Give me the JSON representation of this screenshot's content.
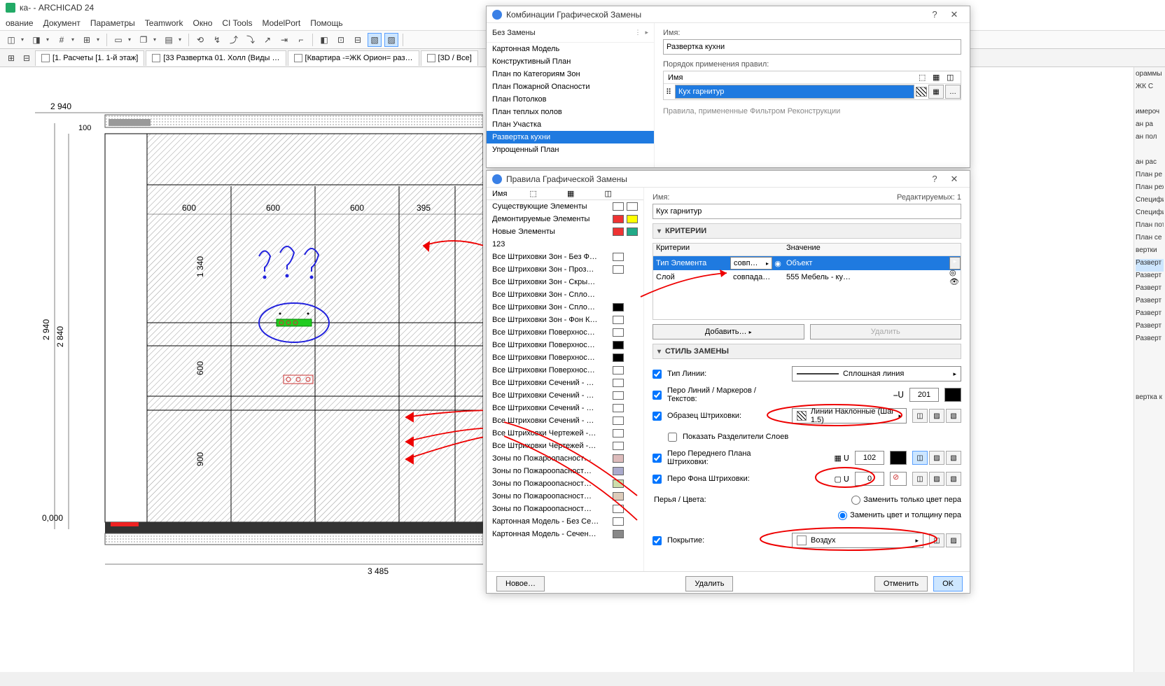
{
  "app": {
    "title": "ка- - ARCHICAD 24"
  },
  "menu": [
    "ование",
    "Документ",
    "Параметры",
    "Teamwork",
    "Окно",
    "CI Tools",
    "ModelPort",
    "Помощь"
  ],
  "tabs": [
    {
      "label": "[1. Расчеты [1. 1-й этаж]"
    },
    {
      "label": "[33 Развертка 01. Холл (Виды …"
    },
    {
      "label": "[Квартира -=ЖК Орион= раз…"
    },
    {
      "label": "[3D / Все]"
    }
  ],
  "rightStrip": [
    "ораммы",
    "ЖК С",
    "",
    "имероч",
    "ан ра",
    "ан пол",
    "",
    "ан рас",
    "План ре",
    "План реж",
    "Специфи",
    "Специфи",
    "План пот",
    "План се",
    "вертки",
    "Разверт",
    "Разверт",
    "Разверт",
    "Разверт",
    "Разверт",
    "Разверт",
    "Разверт",
    "",
    "",
    "вертка к"
  ],
  "dlg1": {
    "title": "Комбинации Графической Замены",
    "leftHeader": "Без Замены",
    "leftList": [
      "Картонная Модель",
      "Конструктивный План",
      "План по Категориям Зон",
      "План Пожарной Опасности",
      "План Потолков",
      "План теплых полов",
      "План Участка",
      "Развертка кухни",
      "Упрощенный План"
    ],
    "selectedIndex": 7,
    "nameLabel": "Имя:",
    "nameValue": "Развертка кухни",
    "orderLabel": "Порядок применения правил:",
    "orderHeader": "Имя",
    "ruleName": "Кух гарнитур",
    "hint": "Правила, примененные Фильтром Реконструкции"
  },
  "dlg2": {
    "title": "Правила Графической Замены",
    "editableLabel": "Редактируемых:",
    "editableCount": "1",
    "leftHeader": "Имя",
    "rules": [
      {
        "name": "Существующие Элементы",
        "c1": "#fff",
        "c2": "#fff"
      },
      {
        "name": "Демонтируемые Элементы",
        "c1": "#e33",
        "c2": "#ff0"
      },
      {
        "name": "Новые Элементы",
        "c1": "#e33",
        "c2": "#2a8"
      },
      {
        "name": "123",
        "c1": "",
        "c2": ""
      },
      {
        "name": "Все Штриховки Зон - Без Ф…",
        "c1": "#fff",
        "c2": ""
      },
      {
        "name": "Все Штриховки Зон - Проз…",
        "c1": "#fff",
        "c2": ""
      },
      {
        "name": "Все Штриховки Зон - Скры…",
        "c1": "",
        "c2": ""
      },
      {
        "name": "Все Штриховки Зон - Спло…",
        "c1": "",
        "c2": ""
      },
      {
        "name": "Все Штриховки Зон - Спло…",
        "c1": "#000",
        "c2": ""
      },
      {
        "name": "Все Штриховки Зон - Фон К…",
        "c1": "#fff",
        "c2": ""
      },
      {
        "name": "Все Штриховки Поверхнос…",
        "c1": "#fff",
        "c2": ""
      },
      {
        "name": "Все Штриховки Поверхнос…",
        "c1": "#000",
        "c2": ""
      },
      {
        "name": "Все Штриховки Поверхнос…",
        "c1": "#000",
        "c2": ""
      },
      {
        "name": "Все Штриховки Поверхнос…",
        "c1": "#fff",
        "c2": ""
      },
      {
        "name": "Все Штриховки Сечений - …",
        "c1": "#fff",
        "c2": ""
      },
      {
        "name": "Все Штриховки Сечений - …",
        "c1": "#fff",
        "c2": ""
      },
      {
        "name": "Все Штриховки Сечений - …",
        "c1": "#fff",
        "c2": ""
      },
      {
        "name": "Все Штриховки Сечений - …",
        "c1": "#fff",
        "c2": ""
      },
      {
        "name": "Все Штриховки Чертежей -…",
        "c1": "#fff",
        "c2": ""
      },
      {
        "name": "Все Штриховки Чертежей -…",
        "c1": "#fff",
        "c2": ""
      },
      {
        "name": "Зоны по Пожароопасност…",
        "c1": "#dbb",
        "c2": ""
      },
      {
        "name": "Зоны по Пожароопасност…",
        "c1": "#aac",
        "c2": ""
      },
      {
        "name": "Зоны по Пожароопасност…",
        "c1": "#cda",
        "c2": ""
      },
      {
        "name": "Зоны по Пожароопасност…",
        "c1": "#dcb",
        "c2": ""
      },
      {
        "name": "Зоны по Пожароопасност…",
        "c1": "#fff",
        "c2": ""
      },
      {
        "name": "Картонная Модель - Без Се…",
        "c1": "#fff",
        "c2": ""
      },
      {
        "name": "Картонная Модель - Сечен…",
        "c1": "#888",
        "c2": ""
      }
    ],
    "nameLabel": "Имя:",
    "nameValue": "Кух гарнитур",
    "critHeader": "КРИТЕРИИ",
    "crit": {
      "h1": "Критерии",
      "h2": "Значение",
      "r1": {
        "c1": "Тип Элемента",
        "op": "совп…",
        "val": "Объект"
      },
      "r2": {
        "c1": "Слой",
        "op": "совпада…",
        "val": "555 Мебель - ку…"
      }
    },
    "addBtn": "Добавить…",
    "delBtn": "Удалить",
    "styleHeader": "СТИЛЬ ЗАМЕНЫ",
    "style": {
      "lineType": "Тип Линии:",
      "lineTypeVal": "Сплошная линия",
      "penLabel": "Перо Линий / Маркеров / Текстов:",
      "penVal": "201",
      "hatchLabel": "Образец Штриховки:",
      "hatchVal": "Линии Наклонные (Шаг 1.5)",
      "sepLabel": "Показать Разделители Слоев",
      "fgLabel": "Перо Переднего Плана Штриховки:",
      "fgVal": "102",
      "bgLabel": "Перо Фона Штриховки:",
      "bgVal": "0",
      "r1": "Заменить только цвет пера",
      "r2": "Заменить цвет и толщину пера",
      "pensLabel": "Перья / Цвета:",
      "covLabel": "Покрытие:",
      "covVal": "Воздух"
    },
    "newBtn": "Новое…",
    "del2Btn": "Удалить",
    "cancel": "Отменить",
    "ok": "OK"
  },
  "dims": {
    "w_total": "2 940",
    "h_total": "2 940",
    "h_inner": "2 840",
    "top_gap": "100",
    "c1": "600",
    "c2": "600",
    "c3": "600",
    "c4": "395",
    "r_top": "1 340",
    "r_mid": "600",
    "r_bot": "900",
    "bot_total": "3 485",
    "zero": "0,000"
  }
}
